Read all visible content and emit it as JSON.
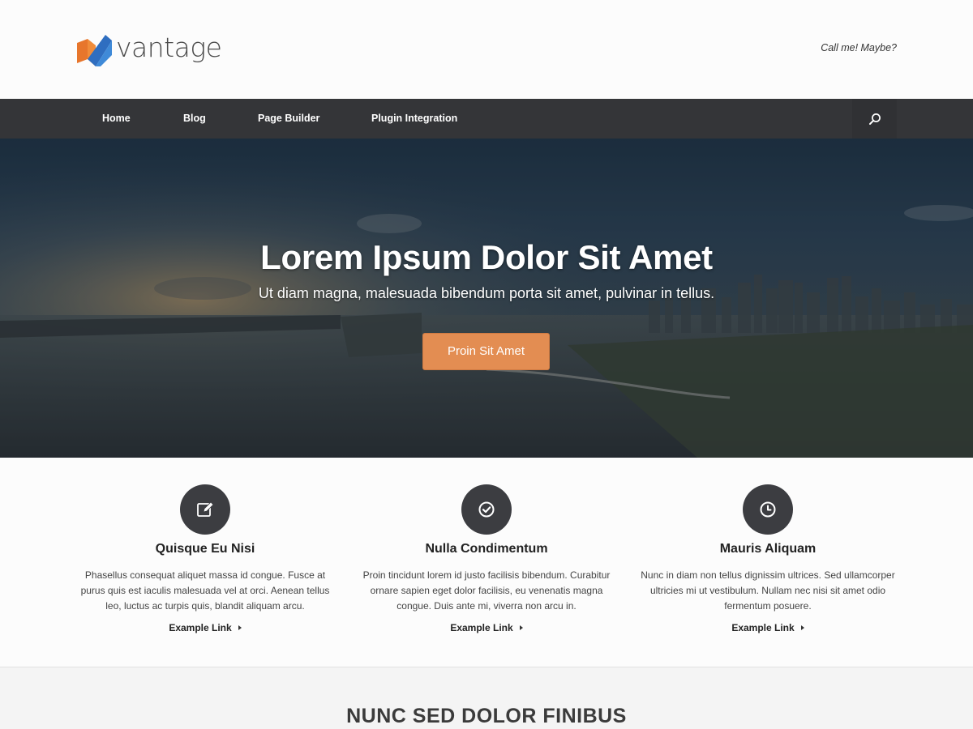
{
  "header": {
    "logo_text": "vantage",
    "tagline": "Call me! Maybe?"
  },
  "nav": {
    "items": [
      {
        "label": "Home"
      },
      {
        "label": "Blog"
      },
      {
        "label": "Page Builder"
      },
      {
        "label": "Plugin Integration"
      }
    ],
    "search_icon": "search-icon"
  },
  "hero": {
    "title": "Lorem Ipsum Dolor Sit Amet",
    "subtitle": "Ut diam magna, malesuada bibendum porta sit amet, pulvinar in tellus.",
    "button_label": "Proin Sit Amet",
    "button_color": "#e38d52"
  },
  "features": [
    {
      "icon": "edit-icon",
      "title": "Quisque Eu Nisi",
      "text": "Phasellus consequat aliquet massa id congue. Fusce at purus quis est iaculis malesuada vel at orci. Aenean tellus leo, luctus ac turpis quis, blandit aliquam arcu.",
      "link": "Example Link"
    },
    {
      "icon": "check-circle-icon",
      "title": "Nulla Condimentum",
      "text": "Proin tincidunt lorem id justo facilisis bibendum. Curabitur ornare sapien eget dolor facilisis, eu venenatis magna congue. Duis ante mi, viverra non arcu in.",
      "link": "Example Link"
    },
    {
      "icon": "clock-icon",
      "title": "Mauris Aliquam",
      "text": "Nunc in diam non tellus dignissim ultrices. Sed ullamcorper ultricies mi ut vestibulum. Nullam nec nisi sit amet odio fermentum posuere.",
      "link": "Example Link"
    }
  ],
  "section": {
    "title": "NUNC SED DOLOR FINIBUS"
  },
  "colors": {
    "nav_bg": "#343538",
    "accent": "#e38d52",
    "icon_circle": "#3c3d41"
  }
}
